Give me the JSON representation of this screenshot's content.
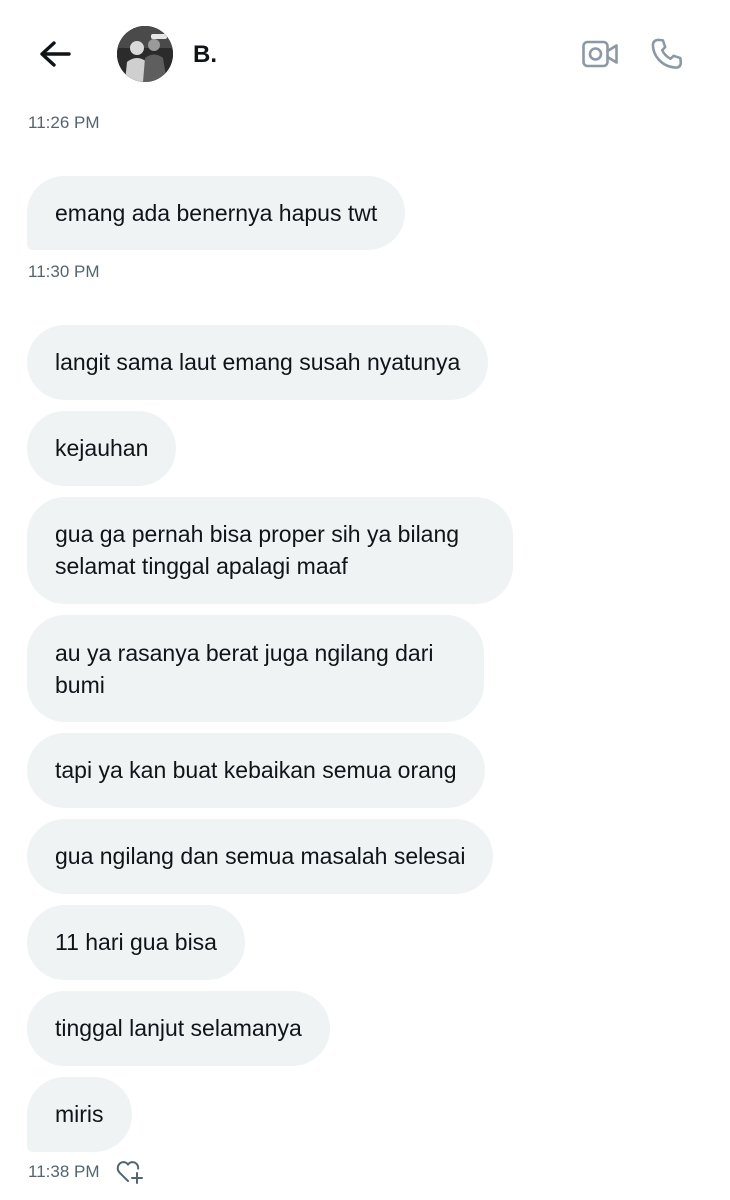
{
  "header": {
    "contact_name": "B.",
    "icons": {
      "back": "arrow-left-icon",
      "video": "video-call-icon",
      "phone": "phone-call-icon"
    }
  },
  "conversation": {
    "timestamps": [
      "11:26 PM",
      "11:30 PM",
      "11:38 PM"
    ],
    "messages": [
      "emang ada benernya hapus twt",
      "langit sama laut emang susah nyatunya",
      "kejauhan",
      "gua ga pernah bisa proper sih ya bilang selamat tinggal apalagi maaf",
      "au ya rasanya berat juga ngilang dari bumi",
      "tapi ya kan buat kebaikan semua orang",
      "gua ngilang dan semua masalah selesai",
      "11 hari gua bisa",
      "tinggal lanjut selamanya",
      "miris"
    ],
    "react_icon": "heart-plus-icon"
  },
  "colors": {
    "bubble_bg": "#eff3f4",
    "text": "#0f1419",
    "secondary_text": "#536471",
    "icon_muted": "#8b98a5"
  }
}
